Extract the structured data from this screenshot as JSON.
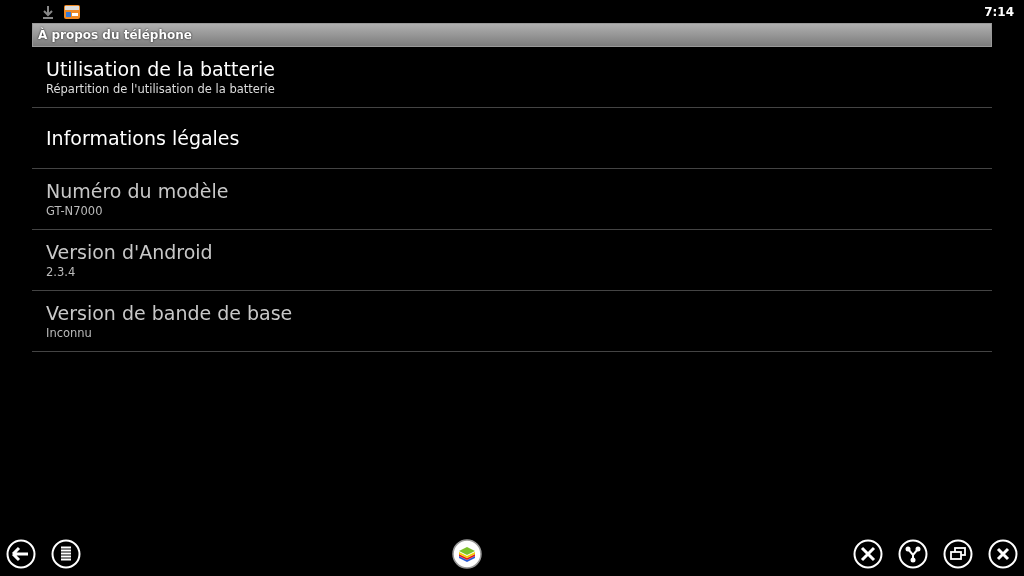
{
  "status_bar": {
    "time": "7:14"
  },
  "title": "À propos du téléphone",
  "items": [
    {
      "title": "Utilisation de la batterie",
      "summary": "Répartition de l'utilisation de la batterie",
      "disabled": false
    },
    {
      "title": "Informations légales",
      "disabled": false
    },
    {
      "title": "Numéro du modèle",
      "summary": "GT-N7000",
      "disabled": true
    },
    {
      "title": "Version d'Android",
      "summary": "2.3.4",
      "disabled": true
    },
    {
      "title": "Version de bande de base",
      "summary": "Inconnu",
      "disabled": true
    }
  ]
}
